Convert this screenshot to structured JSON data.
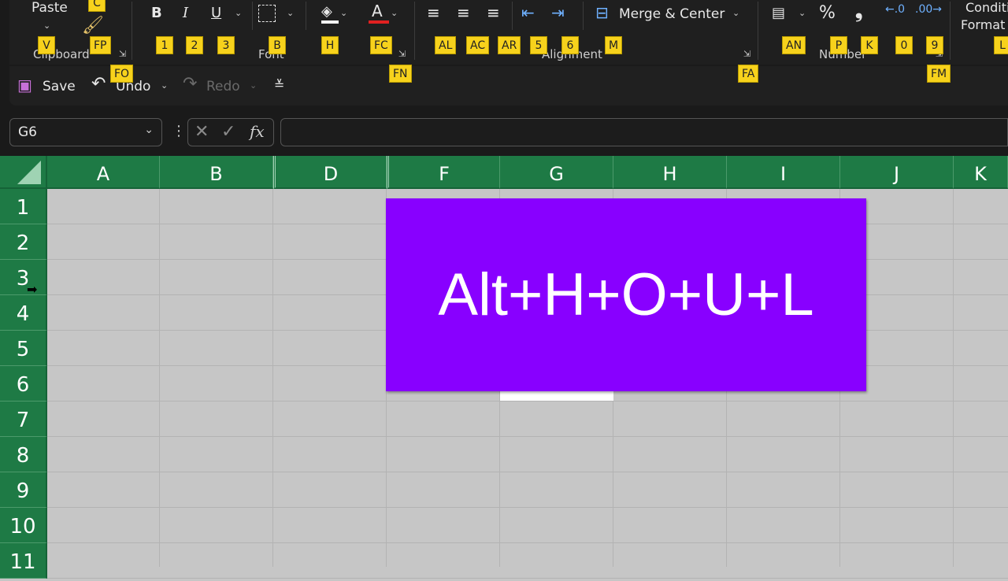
{
  "ribbon": {
    "paste_label": "Paste",
    "group_labels": {
      "clipboard": "Clipboard",
      "font": "Font",
      "alignment": "Alignment",
      "number": "Number"
    },
    "merge_label": "Merge & Center",
    "cond_format_line1": "Conditi",
    "cond_format_line2": "Format",
    "bold": "B",
    "italic": "I",
    "underline": "U",
    "font_color": "A",
    "percent": "%",
    "comma": "❟",
    "keytips": {
      "C": "C",
      "V": "V",
      "FP": "FP",
      "FO": "FO",
      "k1": "1",
      "k2": "2",
      "k3": "3",
      "B": "B",
      "H": "H",
      "FC": "FC",
      "FN": "FN",
      "AL": "AL",
      "AC": "AC",
      "AR": "AR",
      "k5": "5",
      "k6": "6",
      "M": "M",
      "FA": "FA",
      "AN": "AN",
      "P": "P",
      "K": "K",
      "k0": "0",
      "k9": "9",
      "FM": "FM",
      "L": "L"
    }
  },
  "quick_access": {
    "save_label": "Save",
    "undo_label": "Undo",
    "redo_label": "Redo"
  },
  "formula_bar": {
    "name_box": "G6",
    "fx": "fx",
    "formula": ""
  },
  "columns": [
    "A",
    "B",
    "D",
    "F",
    "G",
    "H",
    "I",
    "J",
    "K"
  ],
  "rows": [
    "1",
    "2",
    "3",
    "4",
    "5",
    "6",
    "7",
    "8",
    "9",
    "10",
    "11"
  ],
  "overlay": {
    "shortcut": "Alt+H+O+U+L",
    "color": "#8800ff"
  },
  "colors": {
    "header_green": "#1e7a45",
    "keytip": "#f7d21c",
    "grid_bg": "#c6c6c6"
  }
}
